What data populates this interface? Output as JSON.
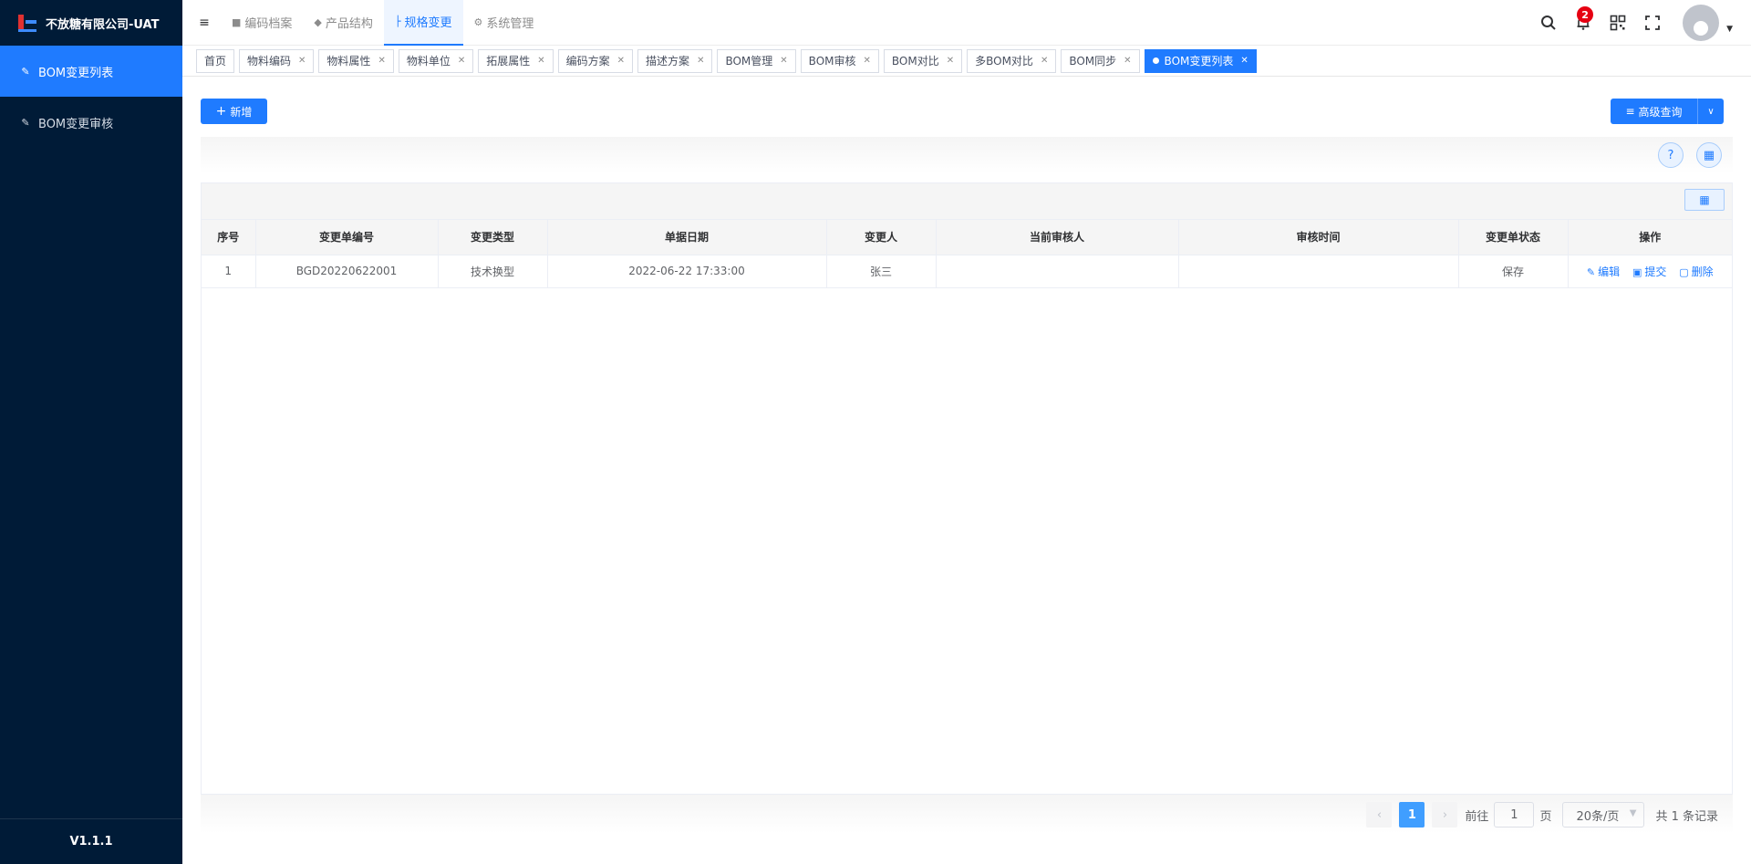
{
  "app": {
    "title": "不放糖有限公司-UAT",
    "version": "V1.1.1"
  },
  "sidebar": {
    "items": [
      {
        "label": "BOM变更列表",
        "active": true
      },
      {
        "label": "BOM变更审核",
        "active": false
      }
    ]
  },
  "header": {
    "collapse_icon": "menu-fold-icon",
    "tabs": [
      {
        "label": "编码档案",
        "icon": "folder-icon"
      },
      {
        "label": "产品结构",
        "icon": "layers-icon"
      },
      {
        "label": "规格变更",
        "icon": "structure-icon",
        "active": true
      },
      {
        "label": "系统管理",
        "icon": "gear-icon"
      }
    ],
    "notification_count": "2"
  },
  "tags": [
    {
      "label": "首页",
      "closable": false
    },
    {
      "label": "物料编码",
      "closable": true
    },
    {
      "label": "物料属性",
      "closable": true
    },
    {
      "label": "物料单位",
      "closable": true
    },
    {
      "label": "拓展属性",
      "closable": true
    },
    {
      "label": "编码方案",
      "closable": true
    },
    {
      "label": "描述方案",
      "closable": true
    },
    {
      "label": "BOM管理",
      "closable": true
    },
    {
      "label": "BOM审核",
      "closable": true
    },
    {
      "label": "BOM对比",
      "closable": true
    },
    {
      "label": "多BOM对比",
      "closable": true
    },
    {
      "label": "BOM同步",
      "closable": true
    },
    {
      "label": "BOM变更列表",
      "closable": true,
      "active": true
    }
  ],
  "toolbar": {
    "add_label": "新增",
    "advanced_query_label": "高级查询"
  },
  "table": {
    "columns": [
      "序号",
      "变更单编号",
      "变更类型",
      "单据日期",
      "变更人",
      "当前审核人",
      "审核时间",
      "变更单状态",
      "操作"
    ],
    "rows": [
      {
        "index": "1",
        "code": "BGD20220622001",
        "type": "技术换型",
        "date": "2022-06-22 17:33:00",
        "changer": "张三",
        "reviewer": "",
        "review_time": "",
        "status": "保存"
      }
    ],
    "actions": {
      "edit": "编辑",
      "submit": "提交",
      "delete": "删除"
    }
  },
  "pagination": {
    "current_page": "1",
    "goto_label": "前往",
    "goto_value": "1",
    "page_suffix": "页",
    "page_size": "20条/页",
    "total_text": "共 1 条记录"
  },
  "colors": {
    "sidebar_bg": "#001b37",
    "accent": "#1f7bff",
    "badge": "#e60012"
  }
}
